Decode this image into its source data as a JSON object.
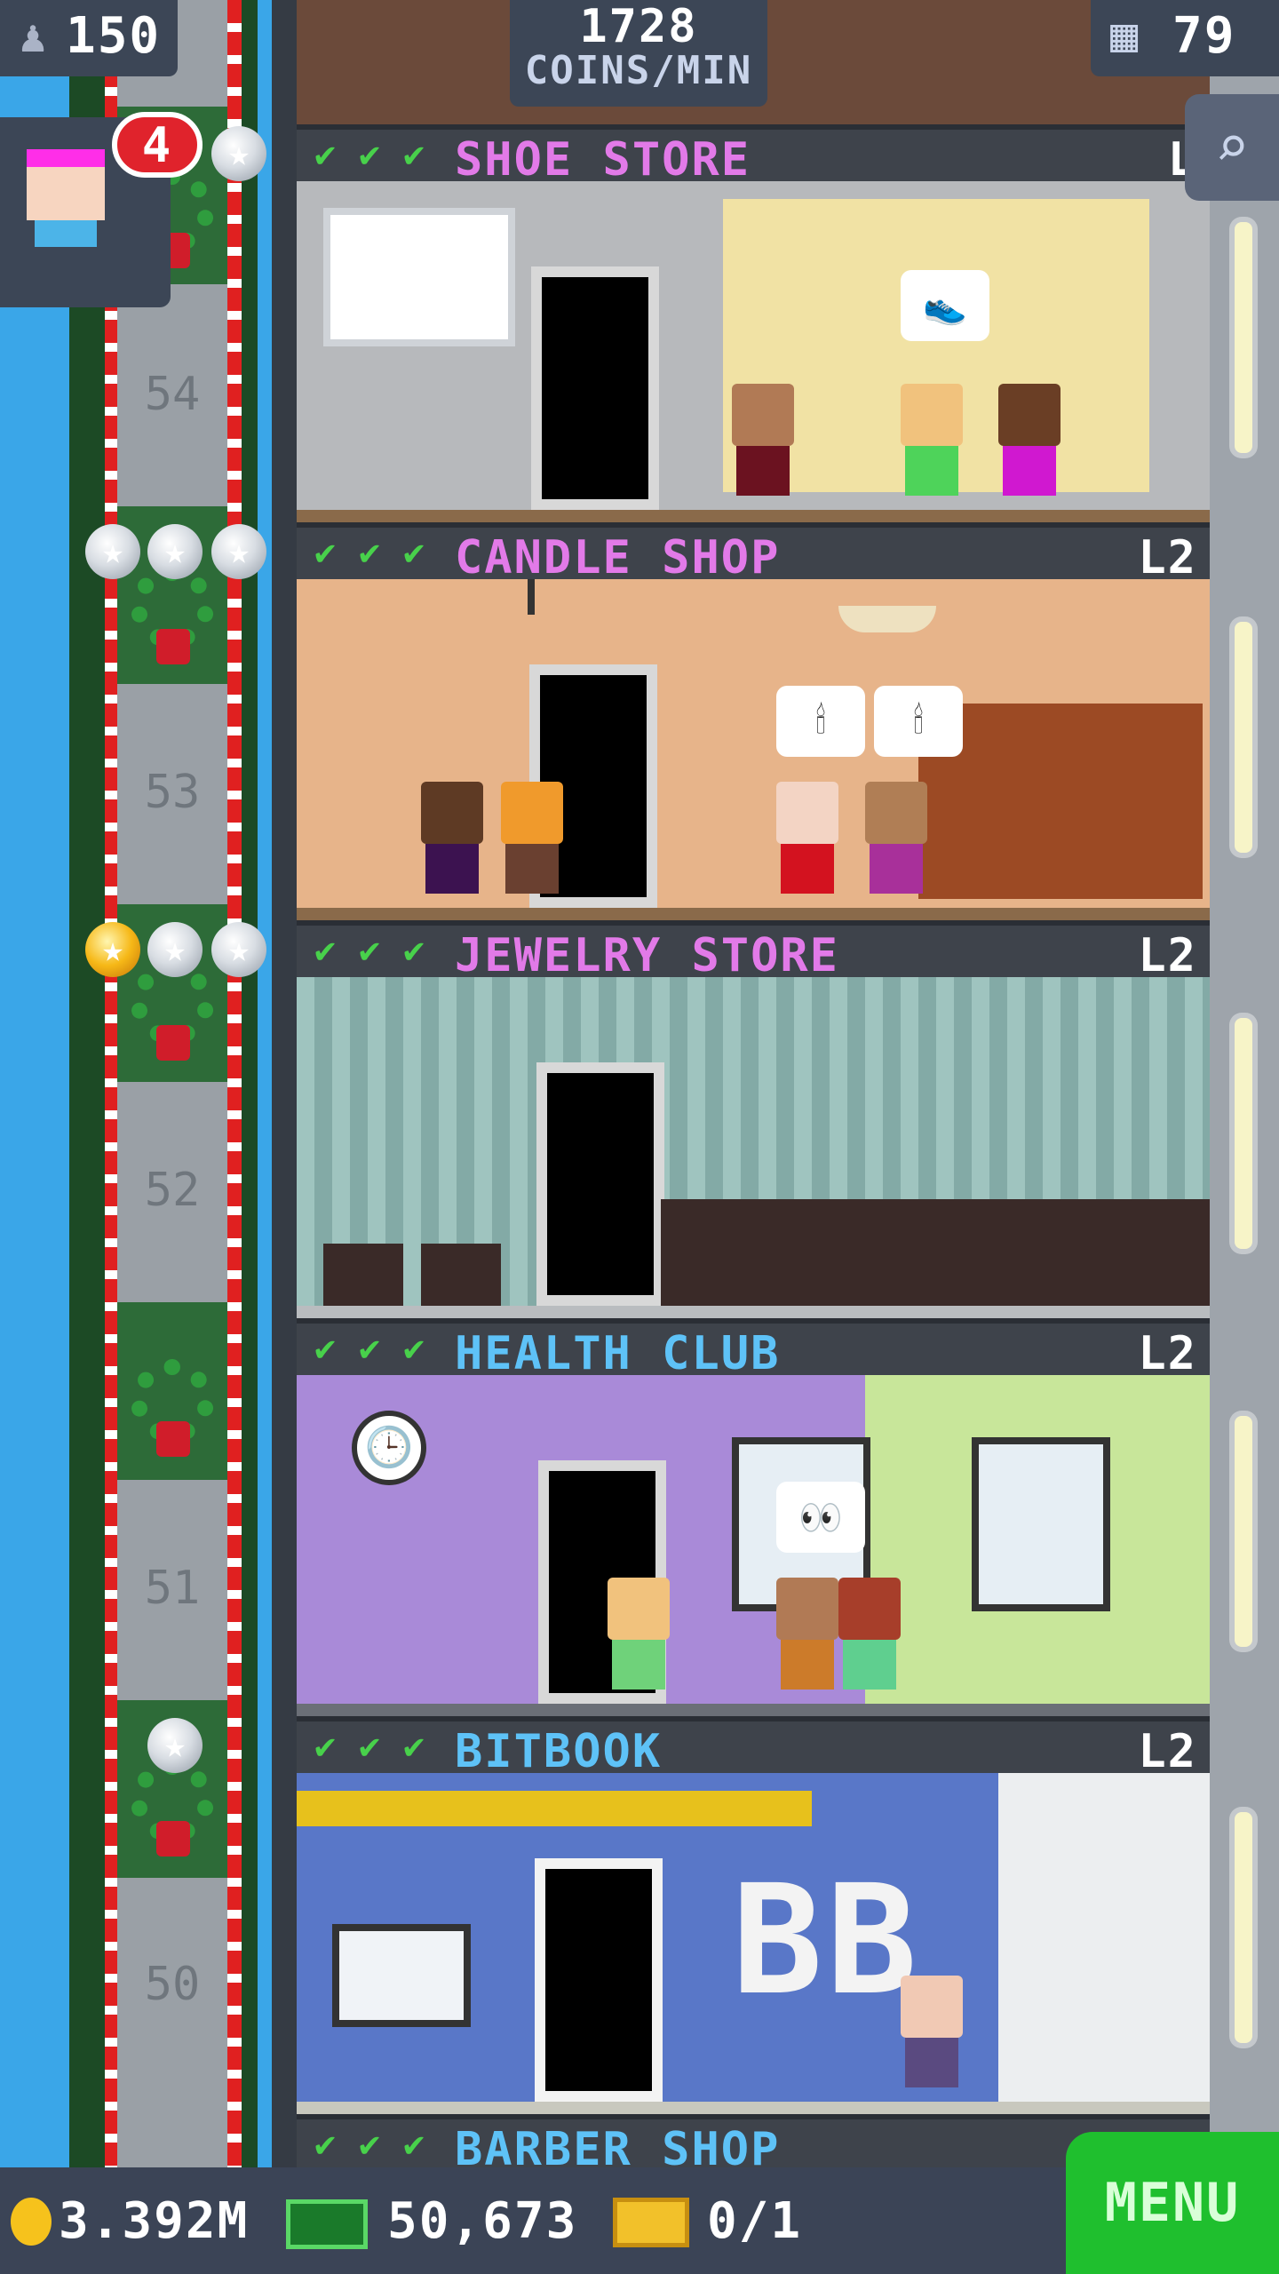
{
  "hud": {
    "population": "150",
    "coins_per_min": "1728",
    "coins_per_min_label": "COINS/MIN",
    "floors": "79",
    "visitor_badge": "4"
  },
  "shaft": {
    "floor_numbers": [
      "54",
      "53",
      "52",
      "51",
      "50"
    ]
  },
  "stores": [
    {
      "name": "SHOE STORE",
      "level": "L",
      "name_color": "#e27ae8"
    },
    {
      "name": "CANDLE SHOP",
      "level": "L2",
      "name_color": "#e27ae8"
    },
    {
      "name": "JEWELRY STORE",
      "level": "L2",
      "name_color": "#e27ae8"
    },
    {
      "name": "HEALTH CLUB",
      "level": "L2",
      "name_color": "#5ec2f7"
    },
    {
      "name": "BITBOOK",
      "level": "L2",
      "name_color": "#5ec2f7"
    },
    {
      "name": "BARBER SHOP",
      "level": "",
      "name_color": "#5ec2f7"
    }
  ],
  "bitbook_logo": "BB",
  "bottom": {
    "coins": "3.392M",
    "bux": "50,673",
    "tickets": "0/1",
    "menu_label": "MENU"
  },
  "colors": {
    "sky": "#3aa6e8",
    "menu_green": "#1fbf2e",
    "check_green": "#48d14b"
  }
}
